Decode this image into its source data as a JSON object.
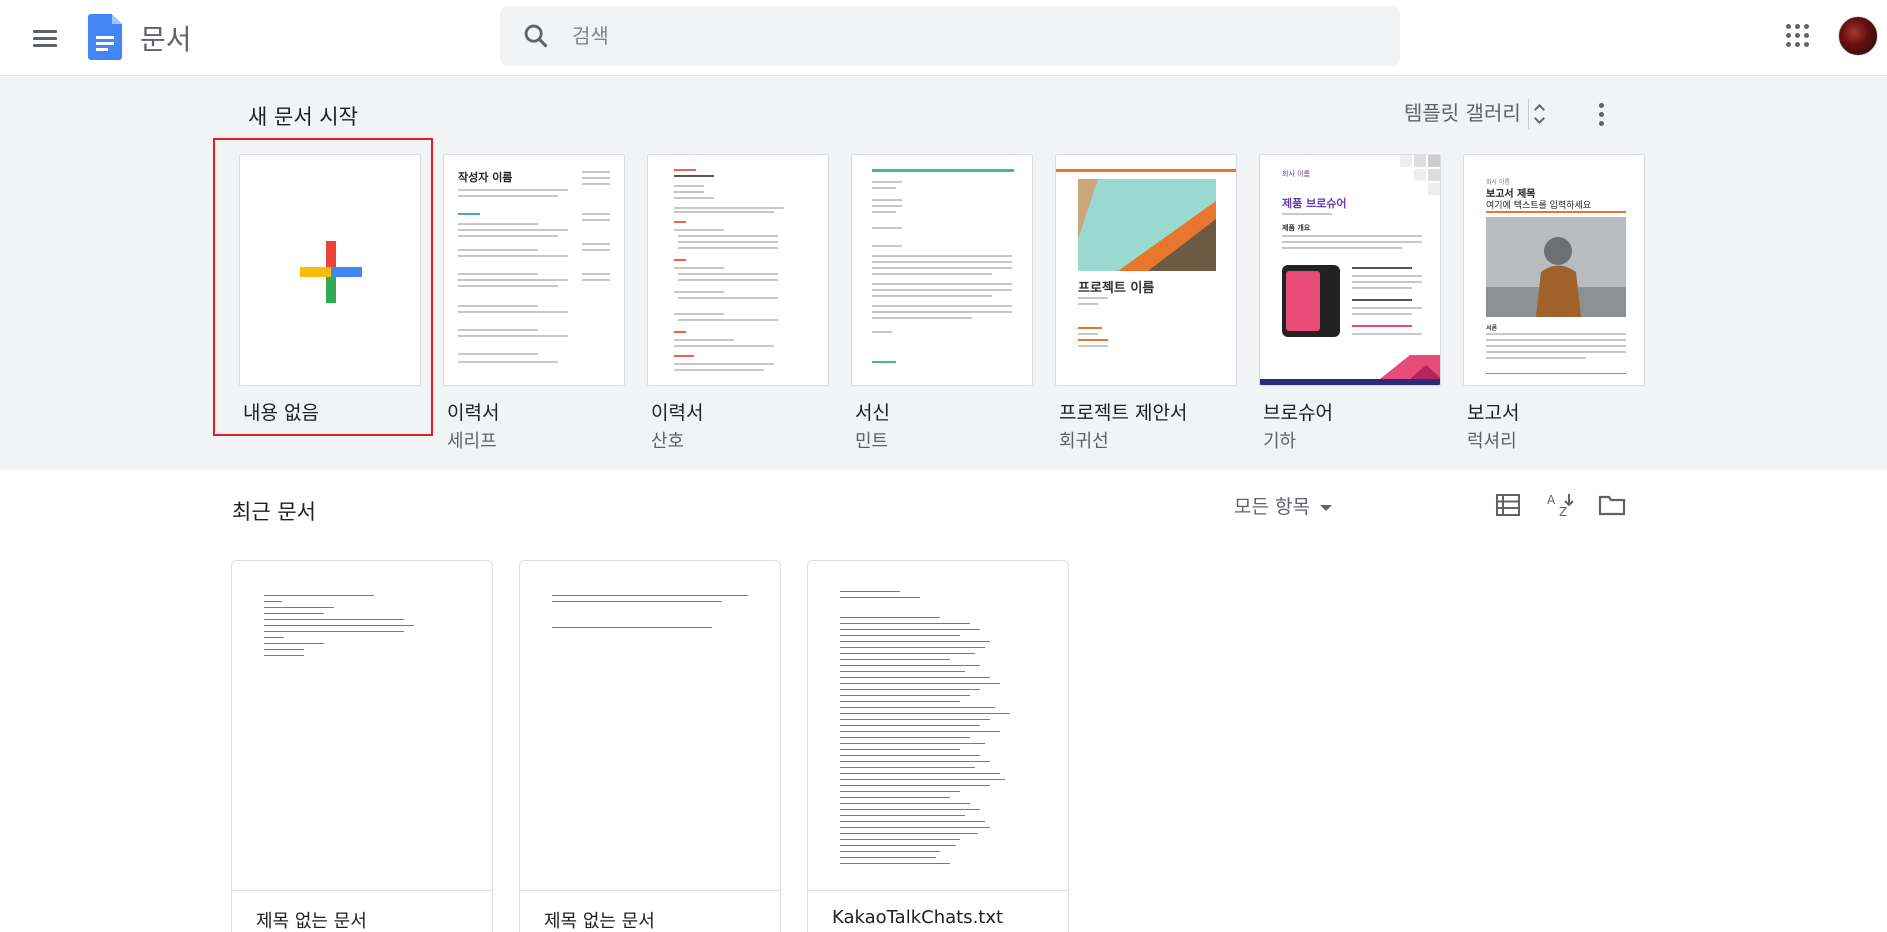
{
  "header": {
    "app_title": "문서",
    "search_placeholder": "검색",
    "icons": [
      "menu-icon",
      "docs-logo-icon",
      "search-icon",
      "apps-grid-icon",
      "avatar"
    ]
  },
  "gallery": {
    "title": "새 문서 시작",
    "toggle_label": "템플릿 갤러리",
    "templates": [
      {
        "name": "내용 없음",
        "sub": ""
      },
      {
        "name": "이력서",
        "sub": "세리프"
      },
      {
        "name": "이력서",
        "sub": "산호"
      },
      {
        "name": "서신",
        "sub": "민트"
      },
      {
        "name": "프로젝트 제안서",
        "sub": "회귀선"
      },
      {
        "name": "브로슈어",
        "sub": "기하"
      },
      {
        "name": "보고서",
        "sub": "럭셔리"
      }
    ],
    "thumb_text": {
      "resume_serif_name": "작성자 이름",
      "project_title": "프로젝트 이름",
      "brochure_company": "회사 이름",
      "brochure_title": "제품 브로슈어",
      "brochure_overview": "제품 개요",
      "report_label": "회사 이름",
      "report_title": "보고서 제목",
      "report_subtitle": "여기에 텍스트를 입력하세요",
      "report_section": "서론"
    }
  },
  "recent": {
    "title": "최근 문서",
    "owner_filter": "모든 항목",
    "docs": [
      {
        "name": "제목 없는 문서"
      },
      {
        "name": "제목 없는 문서"
      },
      {
        "name": "KakaoTalkChats.txt"
      }
    ]
  },
  "colors": {
    "accent_blue": "#4285f4",
    "selection_red": "#e02020",
    "gallery_bg": "#f1f3f4"
  }
}
